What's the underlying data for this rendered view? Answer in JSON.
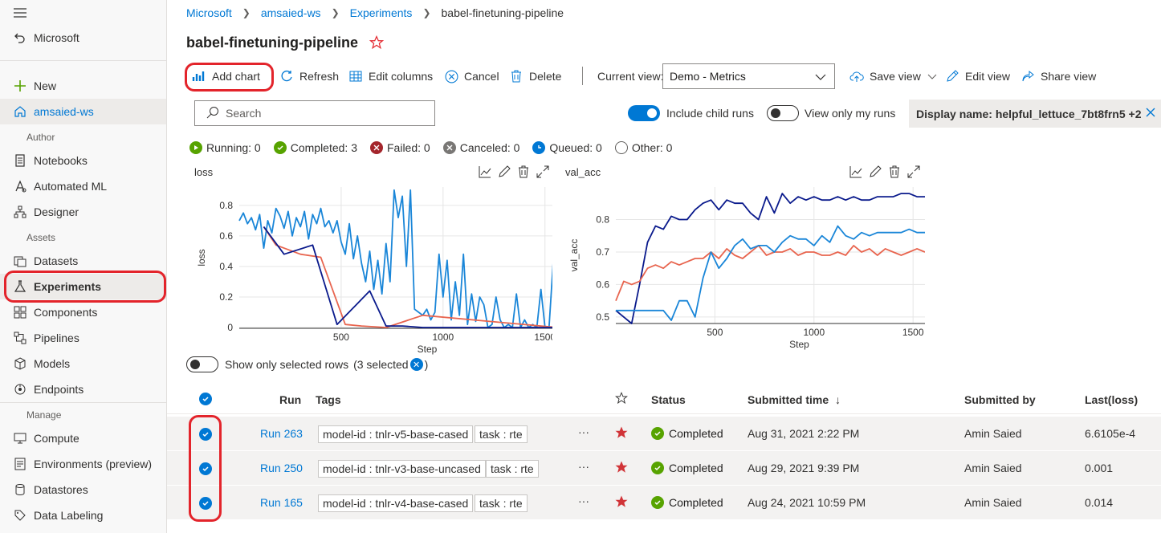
{
  "colors": {
    "accent": "#0078d4",
    "highlight": "#e3242b",
    "success": "#57a300",
    "failed": "#a4262c",
    "series_navy": "#0a1a8c",
    "series_blue": "#1a86d8",
    "series_red": "#e8654f"
  },
  "sidebar": {
    "menu_icon": "hamburger-icon",
    "back_label": "Microsoft",
    "new_label": "New",
    "workspace": "amsaied-ws",
    "sections": {
      "author": "Author",
      "assets": "Assets",
      "manage": "Manage"
    },
    "author_items": [
      "Notebooks",
      "Automated ML",
      "Designer"
    ],
    "asset_items": [
      "Datasets",
      "Experiments",
      "Components",
      "Pipelines",
      "Models",
      "Endpoints"
    ],
    "manage_items": [
      "Compute",
      "Environments (preview)",
      "Datastores",
      "Data Labeling"
    ]
  },
  "breadcrumb": [
    "Microsoft",
    "amsaied-ws",
    "Experiments",
    "babel-finetuning-pipeline"
  ],
  "page_title": "babel-finetuning-pipeline",
  "toolbar": {
    "add_chart": "Add chart",
    "refresh": "Refresh",
    "edit_columns": "Edit columns",
    "cancel": "Cancel",
    "delete": "Delete",
    "current_view_label": "Current view:",
    "current_view_value": "Demo - Metrics",
    "save_view": "Save view",
    "edit_view": "Edit view",
    "share_view": "Share view"
  },
  "search": {
    "placeholder": "Search"
  },
  "toggles": {
    "include_child_runs": "Include child runs",
    "view_only_my_runs": "View only my runs",
    "show_only_selected_rows": "Show only selected rows"
  },
  "filter_chip": "Display name: helpful_lettuce_7bt8frn5 +2",
  "status_counts": [
    {
      "label": "Running: 0"
    },
    {
      "label": "Completed: 3"
    },
    {
      "label": "Failed: 0"
    },
    {
      "label": "Canceled: 0"
    },
    {
      "label": "Queued: 0"
    },
    {
      "label": "Other: 0"
    }
  ],
  "selected_count_prefix": "(3 selected",
  "selected_count_suffix": ")",
  "chart_data": [
    {
      "type": "line",
      "title": "loss",
      "xlabel": "Step",
      "ylabel": "loss",
      "x_ticks": [
        500,
        1000,
        1500
      ],
      "y_ticks": [
        0,
        0.2,
        0.4,
        0.6,
        0.8
      ],
      "xlim": [
        0,
        1560
      ],
      "ylim": [
        -0.005,
        0.92
      ],
      "grid": true,
      "series": [
        {
          "color": "#1a86d8",
          "x": [
            0,
            20,
            40,
            60,
            80,
            100,
            120,
            140,
            160,
            180,
            200,
            220,
            240,
            260,
            280,
            300,
            320,
            340,
            360,
            380,
            400,
            420,
            440,
            460,
            480,
            500,
            520,
            540,
            560,
            580,
            600,
            620,
            640,
            660,
            680,
            700,
            720,
            740,
            760,
            780,
            800,
            820,
            840,
            860,
            880,
            900,
            920,
            940,
            960,
            980,
            1000,
            1020,
            1040,
            1060,
            1080,
            1100,
            1120,
            1140,
            1160,
            1180,
            1200,
            1220,
            1240,
            1260,
            1280,
            1300,
            1320,
            1340,
            1360,
            1380,
            1400,
            1420,
            1440,
            1460,
            1480,
            1500,
            1520,
            1540,
            1560
          ],
          "y": [
            0.7,
            0.75,
            0.68,
            0.72,
            0.64,
            0.74,
            0.52,
            0.7,
            0.62,
            0.78,
            0.73,
            0.65,
            0.76,
            0.6,
            0.72,
            0.66,
            0.76,
            0.58,
            0.74,
            0.68,
            0.78,
            0.66,
            0.7,
            0.62,
            0.7,
            0.56,
            0.48,
            0.68,
            0.45,
            0.6,
            0.42,
            0.3,
            0.5,
            0.25,
            0.44,
            0.22,
            0.55,
            0.3,
            0.9,
            0.72,
            0.86,
            0.4,
            0.9,
            0.12,
            0.1,
            0.08,
            0.12,
            0.05,
            0.1,
            0.48,
            0.2,
            0.44,
            0.05,
            0.3,
            0.08,
            0.48,
            0.02,
            0.22,
            0.04,
            0.2,
            0.15,
            0.0,
            0.02,
            0.2,
            0.05,
            0.0,
            0.02,
            0.0,
            0.22,
            0.0,
            0.05,
            0.0,
            0.02,
            0.0,
            0.25,
            0.0,
            0.0,
            0.42,
            0.02
          ]
        },
        {
          "color": "#e8654f",
          "x": [
            120,
            180,
            300,
            400,
            520,
            600,
            720,
            900,
            1560
          ],
          "y": [
            0.66,
            0.54,
            0.48,
            0.46,
            0.02,
            0.01,
            0.0,
            0.08,
            0.0
          ]
        },
        {
          "color": "#0a1a8c",
          "x": [
            120,
            220,
            360,
            480,
            560,
            640,
            720,
            800,
            900,
            1100,
            1300,
            1560
          ],
          "y": [
            0.66,
            0.48,
            0.54,
            0.02,
            0.13,
            0.24,
            0.01,
            0.01,
            0.0,
            0.0,
            0.0,
            0.0
          ]
        }
      ]
    },
    {
      "type": "line",
      "title": "val_acc",
      "xlabel": "Step",
      "ylabel": "val_acc",
      "x_ticks": [
        500,
        1000,
        1500
      ],
      "y_ticks": [
        0.5,
        0.6,
        0.7,
        0.8
      ],
      "xlim": [
        0,
        1560
      ],
      "ylim": [
        0.48,
        0.9
      ],
      "grid": true,
      "series": [
        {
          "color": "#0a1a8c",
          "x": [
            0,
            40,
            80,
            120,
            160,
            200,
            240,
            280,
            320,
            360,
            400,
            440,
            480,
            520,
            560,
            600,
            640,
            680,
            720,
            760,
            800,
            840,
            880,
            920,
            960,
            1000,
            1040,
            1080,
            1120,
            1160,
            1200,
            1240,
            1280,
            1320,
            1360,
            1400,
            1440,
            1480,
            1520,
            1560
          ],
          "y": [
            0.52,
            0.5,
            0.48,
            0.6,
            0.73,
            0.78,
            0.77,
            0.81,
            0.8,
            0.8,
            0.83,
            0.85,
            0.86,
            0.83,
            0.86,
            0.85,
            0.85,
            0.82,
            0.8,
            0.87,
            0.82,
            0.88,
            0.85,
            0.87,
            0.86,
            0.87,
            0.86,
            0.86,
            0.87,
            0.86,
            0.87,
            0.86,
            0.86,
            0.87,
            0.87,
            0.87,
            0.88,
            0.88,
            0.87,
            0.87
          ]
        },
        {
          "color": "#e8654f",
          "x": [
            0,
            40,
            80,
            120,
            160,
            200,
            240,
            280,
            320,
            360,
            400,
            440,
            480,
            520,
            560,
            600,
            640,
            680,
            720,
            760,
            800,
            840,
            880,
            920,
            960,
            1000,
            1040,
            1080,
            1120,
            1160,
            1200,
            1240,
            1280,
            1320,
            1360,
            1400,
            1440,
            1480,
            1520,
            1560
          ],
          "y": [
            0.55,
            0.61,
            0.6,
            0.61,
            0.65,
            0.66,
            0.65,
            0.67,
            0.66,
            0.67,
            0.68,
            0.68,
            0.7,
            0.68,
            0.71,
            0.69,
            0.68,
            0.7,
            0.72,
            0.69,
            0.7,
            0.7,
            0.71,
            0.69,
            0.7,
            0.7,
            0.69,
            0.69,
            0.7,
            0.69,
            0.72,
            0.7,
            0.71,
            0.69,
            0.71,
            0.7,
            0.69,
            0.7,
            0.71,
            0.7
          ]
        },
        {
          "color": "#1a86d8",
          "x": [
            0,
            40,
            80,
            120,
            160,
            200,
            240,
            280,
            320,
            360,
            400,
            440,
            480,
            520,
            560,
            600,
            640,
            680,
            720,
            760,
            800,
            840,
            880,
            920,
            960,
            1000,
            1040,
            1080,
            1120,
            1160,
            1200,
            1240,
            1280,
            1320,
            1360,
            1400,
            1440,
            1480,
            1520,
            1560
          ],
          "y": [
            0.52,
            0.52,
            0.52,
            0.52,
            0.52,
            0.52,
            0.52,
            0.49,
            0.55,
            0.55,
            0.5,
            0.62,
            0.7,
            0.65,
            0.68,
            0.72,
            0.74,
            0.71,
            0.72,
            0.72,
            0.7,
            0.73,
            0.75,
            0.74,
            0.74,
            0.72,
            0.75,
            0.73,
            0.78,
            0.75,
            0.74,
            0.76,
            0.75,
            0.76,
            0.76,
            0.76,
            0.76,
            0.77,
            0.76,
            0.76
          ]
        }
      ]
    }
  ],
  "table": {
    "headers": {
      "run": "Run",
      "tags": "Tags",
      "status": "Status",
      "submitted_time": "Submitted time",
      "submitted_by": "Submitted by",
      "last_loss": "Last(loss)"
    },
    "rows": [
      {
        "run": "Run 263",
        "tag1": "model-id : tnlr-v5-base-cased",
        "tag2": "task : rte",
        "more": "···",
        "status": "Completed",
        "submitted_time": "Aug 31, 2021 2:22 PM",
        "submitted_by": "Amin Saied",
        "last_loss": "6.6105e-4"
      },
      {
        "run": "Run 250",
        "tag1": "model-id : tnlr-v3-base-uncased",
        "tag2": "task : rte",
        "more": "···",
        "status": "Completed",
        "submitted_time": "Aug 29, 2021 9:39 PM",
        "submitted_by": "Amin Saied",
        "last_loss": "0.001"
      },
      {
        "run": "Run 165",
        "tag1": "model-id : tnlr-v4-base-cased",
        "tag2": "task : rte",
        "more": "···",
        "status": "Completed",
        "submitted_time": "Aug 24, 2021 10:59 PM",
        "submitted_by": "Amin Saied",
        "last_loss": "0.014"
      }
    ]
  }
}
